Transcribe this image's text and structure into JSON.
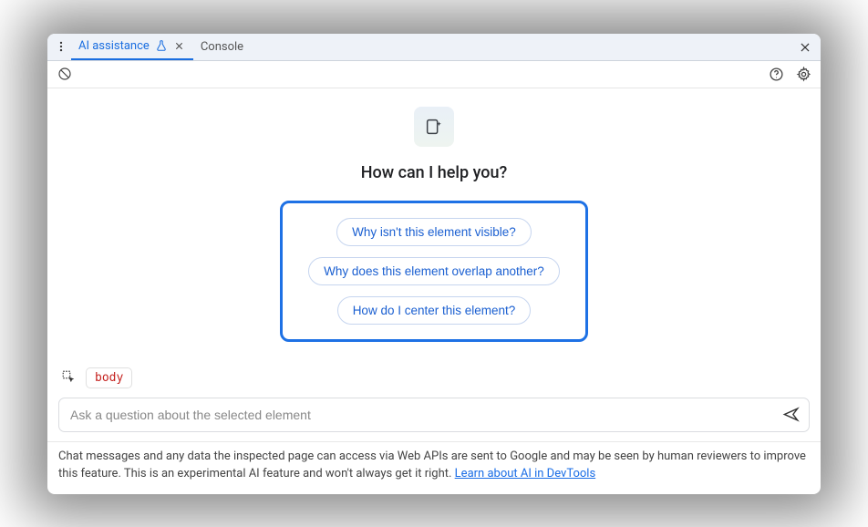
{
  "tabs": {
    "active": {
      "label": "AI assistance"
    },
    "secondary": {
      "label": "Console"
    }
  },
  "heading": "How can I help you?",
  "suggestions": [
    "Why isn't this element visible?",
    "Why does this element overlap another?",
    "How do I center this element?"
  ],
  "context": {
    "element": "body"
  },
  "prompt": {
    "placeholder": "Ask a question about the selected element"
  },
  "disclaimer": {
    "text": "Chat messages and any data the inspected page can access via Web APIs are sent to Google and may be seen by human reviewers to improve this feature. This is an experimental AI feature and won't always get it right. ",
    "link": "Learn about AI in DevTools"
  }
}
